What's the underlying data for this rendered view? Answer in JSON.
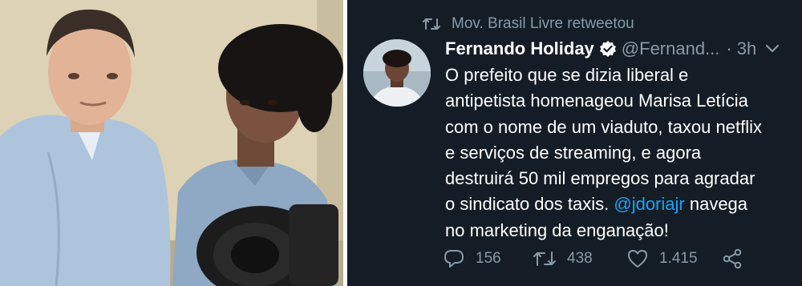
{
  "tweet": {
    "retweet_label": "Mov. Brasil Livre retweetou",
    "author_name": "Fernando Holiday",
    "author_handle": "@Fernand...",
    "separator": "·",
    "time": "3h",
    "body_lines": [
      "O prefeito que se dizia liberal e",
      "antipetista homenageou Marisa Letícia",
      "com o nome de um viaduto, taxou netflix",
      "e serviços de streaming, e agora",
      "destruirá 50 mil empregos para agradar",
      "o sindicato dos taxis.",
      "no marketing da enganação!"
    ],
    "mention": "@jdoriajr",
    "line6_suffix": "navega",
    "replies": "156",
    "retweets": "438",
    "likes": "1.415"
  },
  "colors": {
    "background": "#141d26",
    "muted": "#8899a6",
    "link": "#1da1f2",
    "text": "#ffffff"
  },
  "icons": {
    "retweet": "retweet-icon",
    "verified": "verified-badge-icon",
    "menu": "chevron-down-icon",
    "reply": "reply-icon",
    "like": "heart-icon",
    "share": "share-icon"
  }
}
